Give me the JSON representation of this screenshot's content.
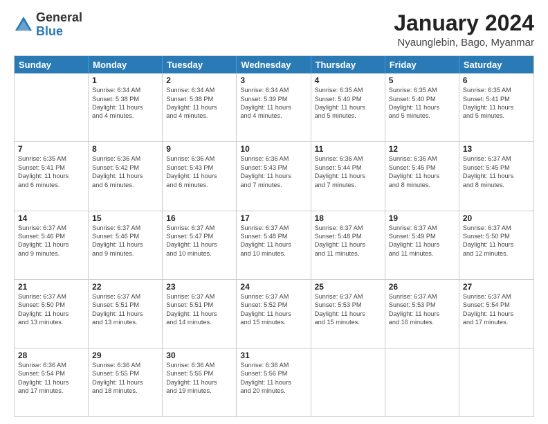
{
  "logo": {
    "general": "General",
    "blue": "Blue"
  },
  "title": "January 2024",
  "location": "Nyaunglebin, Bago, Myanmar",
  "header_days": [
    "Sunday",
    "Monday",
    "Tuesday",
    "Wednesday",
    "Thursday",
    "Friday",
    "Saturday"
  ],
  "weeks": [
    [
      {
        "day": "",
        "lines": []
      },
      {
        "day": "1",
        "lines": [
          "Sunrise: 6:34 AM",
          "Sunset: 5:38 PM",
          "Daylight: 11 hours",
          "and 4 minutes."
        ]
      },
      {
        "day": "2",
        "lines": [
          "Sunrise: 6:34 AM",
          "Sunset: 5:38 PM",
          "Daylight: 11 hours",
          "and 4 minutes."
        ]
      },
      {
        "day": "3",
        "lines": [
          "Sunrise: 6:34 AM",
          "Sunset: 5:39 PM",
          "Daylight: 11 hours",
          "and 4 minutes."
        ]
      },
      {
        "day": "4",
        "lines": [
          "Sunrise: 6:35 AM",
          "Sunset: 5:40 PM",
          "Daylight: 11 hours",
          "and 5 minutes."
        ]
      },
      {
        "day": "5",
        "lines": [
          "Sunrise: 6:35 AM",
          "Sunset: 5:40 PM",
          "Daylight: 11 hours",
          "and 5 minutes."
        ]
      },
      {
        "day": "6",
        "lines": [
          "Sunrise: 6:35 AM",
          "Sunset: 5:41 PM",
          "Daylight: 11 hours",
          "and 5 minutes."
        ]
      }
    ],
    [
      {
        "day": "7",
        "lines": [
          "Sunrise: 6:35 AM",
          "Sunset: 5:41 PM",
          "Daylight: 11 hours",
          "and 6 minutes."
        ]
      },
      {
        "day": "8",
        "lines": [
          "Sunrise: 6:36 AM",
          "Sunset: 5:42 PM",
          "Daylight: 11 hours",
          "and 6 minutes."
        ]
      },
      {
        "day": "9",
        "lines": [
          "Sunrise: 6:36 AM",
          "Sunset: 5:43 PM",
          "Daylight: 11 hours",
          "and 6 minutes."
        ]
      },
      {
        "day": "10",
        "lines": [
          "Sunrise: 6:36 AM",
          "Sunset: 5:43 PM",
          "Daylight: 11 hours",
          "and 7 minutes."
        ]
      },
      {
        "day": "11",
        "lines": [
          "Sunrise: 6:36 AM",
          "Sunset: 5:44 PM",
          "Daylight: 11 hours",
          "and 7 minutes."
        ]
      },
      {
        "day": "12",
        "lines": [
          "Sunrise: 6:36 AM",
          "Sunset: 5:45 PM",
          "Daylight: 11 hours",
          "and 8 minutes."
        ]
      },
      {
        "day": "13",
        "lines": [
          "Sunrise: 6:37 AM",
          "Sunset: 5:45 PM",
          "Daylight: 11 hours",
          "and 8 minutes."
        ]
      }
    ],
    [
      {
        "day": "14",
        "lines": [
          "Sunrise: 6:37 AM",
          "Sunset: 5:46 PM",
          "Daylight: 11 hours",
          "and 9 minutes."
        ]
      },
      {
        "day": "15",
        "lines": [
          "Sunrise: 6:37 AM",
          "Sunset: 5:46 PM",
          "Daylight: 11 hours",
          "and 9 minutes."
        ]
      },
      {
        "day": "16",
        "lines": [
          "Sunrise: 6:37 AM",
          "Sunset: 5:47 PM",
          "Daylight: 11 hours",
          "and 10 minutes."
        ]
      },
      {
        "day": "17",
        "lines": [
          "Sunrise: 6:37 AM",
          "Sunset: 5:48 PM",
          "Daylight: 11 hours",
          "and 10 minutes."
        ]
      },
      {
        "day": "18",
        "lines": [
          "Sunrise: 6:37 AM",
          "Sunset: 5:48 PM",
          "Daylight: 11 hours",
          "and 11 minutes."
        ]
      },
      {
        "day": "19",
        "lines": [
          "Sunrise: 6:37 AM",
          "Sunset: 5:49 PM",
          "Daylight: 11 hours",
          "and 11 minutes."
        ]
      },
      {
        "day": "20",
        "lines": [
          "Sunrise: 6:37 AM",
          "Sunset: 5:50 PM",
          "Daylight: 11 hours",
          "and 12 minutes."
        ]
      }
    ],
    [
      {
        "day": "21",
        "lines": [
          "Sunrise: 6:37 AM",
          "Sunset: 5:50 PM",
          "Daylight: 11 hours",
          "and 13 minutes."
        ]
      },
      {
        "day": "22",
        "lines": [
          "Sunrise: 6:37 AM",
          "Sunset: 5:51 PM",
          "Daylight: 11 hours",
          "and 13 minutes."
        ]
      },
      {
        "day": "23",
        "lines": [
          "Sunrise: 6:37 AM",
          "Sunset: 5:51 PM",
          "Daylight: 11 hours",
          "and 14 minutes."
        ]
      },
      {
        "day": "24",
        "lines": [
          "Sunrise: 6:37 AM",
          "Sunset: 5:52 PM",
          "Daylight: 11 hours",
          "and 15 minutes."
        ]
      },
      {
        "day": "25",
        "lines": [
          "Sunrise: 6:37 AM",
          "Sunset: 5:53 PM",
          "Daylight: 11 hours",
          "and 15 minutes."
        ]
      },
      {
        "day": "26",
        "lines": [
          "Sunrise: 6:37 AM",
          "Sunset: 5:53 PM",
          "Daylight: 11 hours",
          "and 16 minutes."
        ]
      },
      {
        "day": "27",
        "lines": [
          "Sunrise: 6:37 AM",
          "Sunset: 5:54 PM",
          "Daylight: 11 hours",
          "and 17 minutes."
        ]
      }
    ],
    [
      {
        "day": "28",
        "lines": [
          "Sunrise: 6:36 AM",
          "Sunset: 5:54 PM",
          "Daylight: 11 hours",
          "and 17 minutes."
        ]
      },
      {
        "day": "29",
        "lines": [
          "Sunrise: 6:36 AM",
          "Sunset: 5:55 PM",
          "Daylight: 11 hours",
          "and 18 minutes."
        ]
      },
      {
        "day": "30",
        "lines": [
          "Sunrise: 6:36 AM",
          "Sunset: 5:55 PM",
          "Daylight: 11 hours",
          "and 19 minutes."
        ]
      },
      {
        "day": "31",
        "lines": [
          "Sunrise: 6:36 AM",
          "Sunset: 5:56 PM",
          "Daylight: 11 hours",
          "and 20 minutes."
        ]
      },
      {
        "day": "",
        "lines": []
      },
      {
        "day": "",
        "lines": []
      },
      {
        "day": "",
        "lines": []
      }
    ]
  ]
}
